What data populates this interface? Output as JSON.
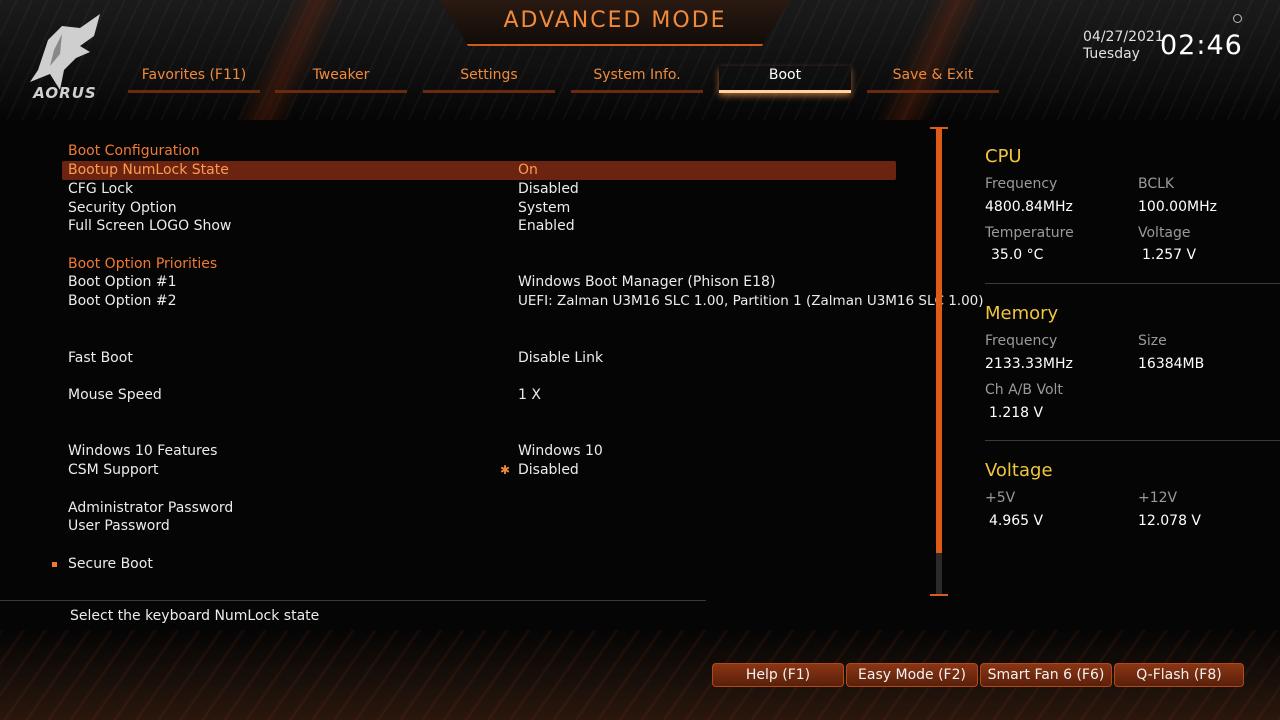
{
  "header": {
    "title": "ADVANCED MODE",
    "brand": "AORUS",
    "date": "04/27/2021",
    "weekday": "Tuesday",
    "time": "02:46"
  },
  "tabs": [
    {
      "label": "Favorites (F11)"
    },
    {
      "label": "Tweaker"
    },
    {
      "label": "Settings"
    },
    {
      "label": "System Info."
    },
    {
      "label": "Boot",
      "active": true
    },
    {
      "label": "Save & Exit"
    }
  ],
  "boot": {
    "section_config": "Boot Configuration",
    "numlock": {
      "label": "Bootup NumLock State",
      "value": "On"
    },
    "cfg_lock": {
      "label": "CFG Lock",
      "value": "Disabled"
    },
    "security": {
      "label": "Security Option",
      "value": "System"
    },
    "logo_show": {
      "label": "Full Screen LOGO Show",
      "value": "Enabled"
    },
    "section_priorities": "Boot Option Priorities",
    "option1": {
      "label": "Boot Option #1",
      "value": "Windows Boot Manager (Phison E18)"
    },
    "option2": {
      "label": "Boot Option #2",
      "value": "UEFI: Zalman U3M16 SLC 1.00, Partition 1 (Zalman U3M16 SLC 1.00)"
    },
    "fast_boot": {
      "label": "Fast Boot",
      "value": "Disable Link"
    },
    "mouse_speed": {
      "label": "Mouse Speed",
      "value": "1 X"
    },
    "win10": {
      "label": "Windows 10 Features",
      "value": "Windows 10"
    },
    "csm": {
      "label": "CSM Support",
      "value": "Disabled"
    },
    "admin_pw": {
      "label": "Administrator Password"
    },
    "user_pw": {
      "label": "User Password"
    },
    "secure_boot": {
      "label": "Secure Boot"
    }
  },
  "help_text": "Select the keyboard NumLock state",
  "panel": {
    "cpu": {
      "title": "CPU",
      "freq_label": "Frequency",
      "freq": "4800.84MHz",
      "bclk_label": "BCLK",
      "bclk": "100.00MHz",
      "temp_label": "Temperature",
      "temp": "35.0 °C",
      "volt_label": "Voltage",
      "volt": "1.257 V"
    },
    "memory": {
      "title": "Memory",
      "freq_label": "Frequency",
      "freq": "2133.33MHz",
      "size_label": "Size",
      "size": "16384MB",
      "chvolt_label": "Ch A/B Volt",
      "chvolt": "1.218 V"
    },
    "voltage": {
      "title": "Voltage",
      "v5_label": "+5V",
      "v5": "4.965 V",
      "v12_label": "+12V",
      "v12": "12.078 V"
    }
  },
  "footer": {
    "help": "Help (F1)",
    "easy": "Easy Mode (F2)",
    "smartfan": "Smart Fan 6 (F6)",
    "qflash": "Q-Flash (F8)"
  },
  "colors": {
    "accent": "#f07a34",
    "selected_bg": "#6b2410",
    "panel_title": "#f0c63c"
  }
}
